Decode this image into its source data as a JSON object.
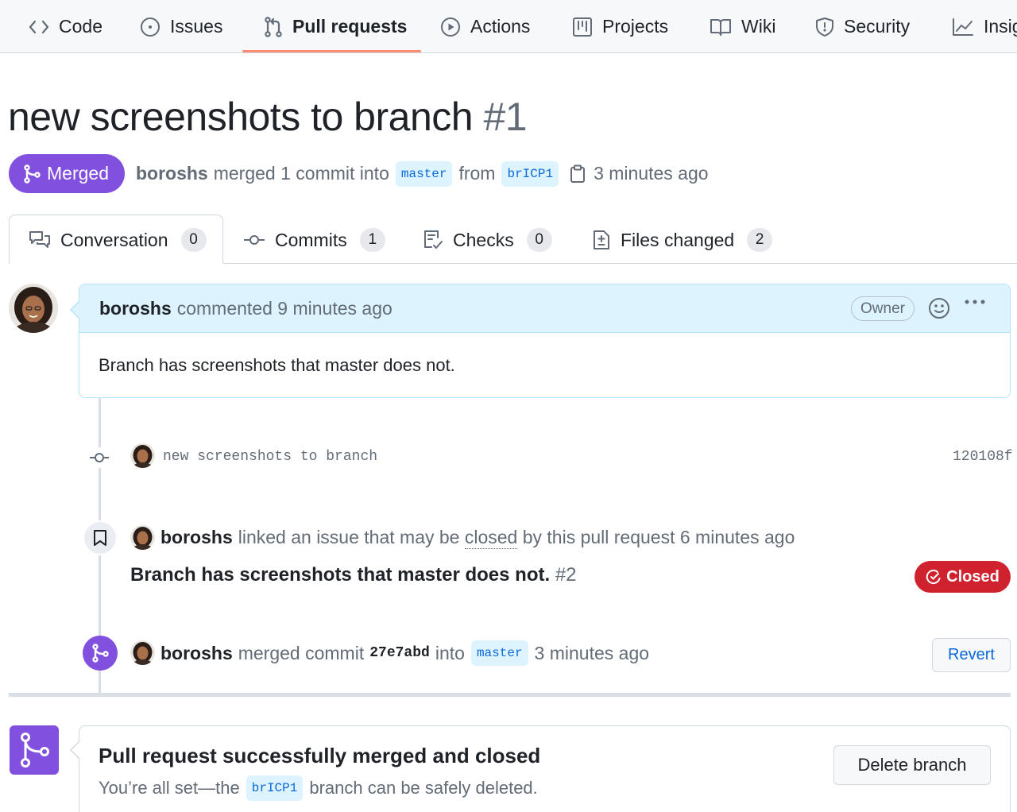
{
  "repo_nav": {
    "items": [
      {
        "label": "Code",
        "icon": "code-icon"
      },
      {
        "label": "Issues",
        "icon": "issue-opened-icon"
      },
      {
        "label": "Pull requests",
        "icon": "git-pull-request-icon",
        "active": true
      },
      {
        "label": "Actions",
        "icon": "play-icon"
      },
      {
        "label": "Projects",
        "icon": "table-icon"
      },
      {
        "label": "Wiki",
        "icon": "book-icon"
      },
      {
        "label": "Security",
        "icon": "shield-icon"
      },
      {
        "label": "Insights",
        "icon": "graph-icon"
      }
    ]
  },
  "pr": {
    "title": "new screenshots to branch",
    "number": "#1",
    "status": "Merged",
    "author": "boroshs",
    "merge_summary": "merged 1 commit into",
    "base_branch": "master",
    "from_word": "from",
    "head_branch": "brICP1",
    "merged_time": "3 minutes ago"
  },
  "tabs": [
    {
      "label": "Conversation",
      "count": "0",
      "icon": "comment-discussion-icon",
      "active": true
    },
    {
      "label": "Commits",
      "count": "1",
      "icon": "git-commit-icon"
    },
    {
      "label": "Checks",
      "count": "0",
      "icon": "checklist-icon"
    },
    {
      "label": "Files changed",
      "count": "2",
      "icon": "file-diff-icon"
    }
  ],
  "comment": {
    "author": "boroshs",
    "action": "commented 9 minutes ago",
    "role_label": "Owner",
    "body": "Branch has screenshots that master does not."
  },
  "commit_event": {
    "message": "new screenshots to branch",
    "sha": "120108f"
  },
  "linked_issue_event": {
    "author": "boroshs",
    "text_before": "linked an issue that may be",
    "closed_word": "closed",
    "text_after": "by this pull request 6 minutes ago",
    "issue_title": "Branch has screenshots that master does not.",
    "issue_number": "#2",
    "issue_state": "Closed"
  },
  "merge_event": {
    "author": "boroshs",
    "text": "merged commit",
    "sha": "27e7abd",
    "into_word": "into",
    "branch": "master",
    "time": "3 minutes ago",
    "revert_label": "Revert"
  },
  "merge_box": {
    "title": "Pull request successfully merged and closed",
    "sub_before": "You’re all set—the",
    "branch": "brICP1",
    "sub_after": "branch can be safely deleted.",
    "delete_label": "Delete branch"
  },
  "colors": {
    "merged_purple": "#8250df",
    "closed_red": "#cf222e",
    "link_blue": "#0969da",
    "nav_underline": "#fd8c73"
  }
}
